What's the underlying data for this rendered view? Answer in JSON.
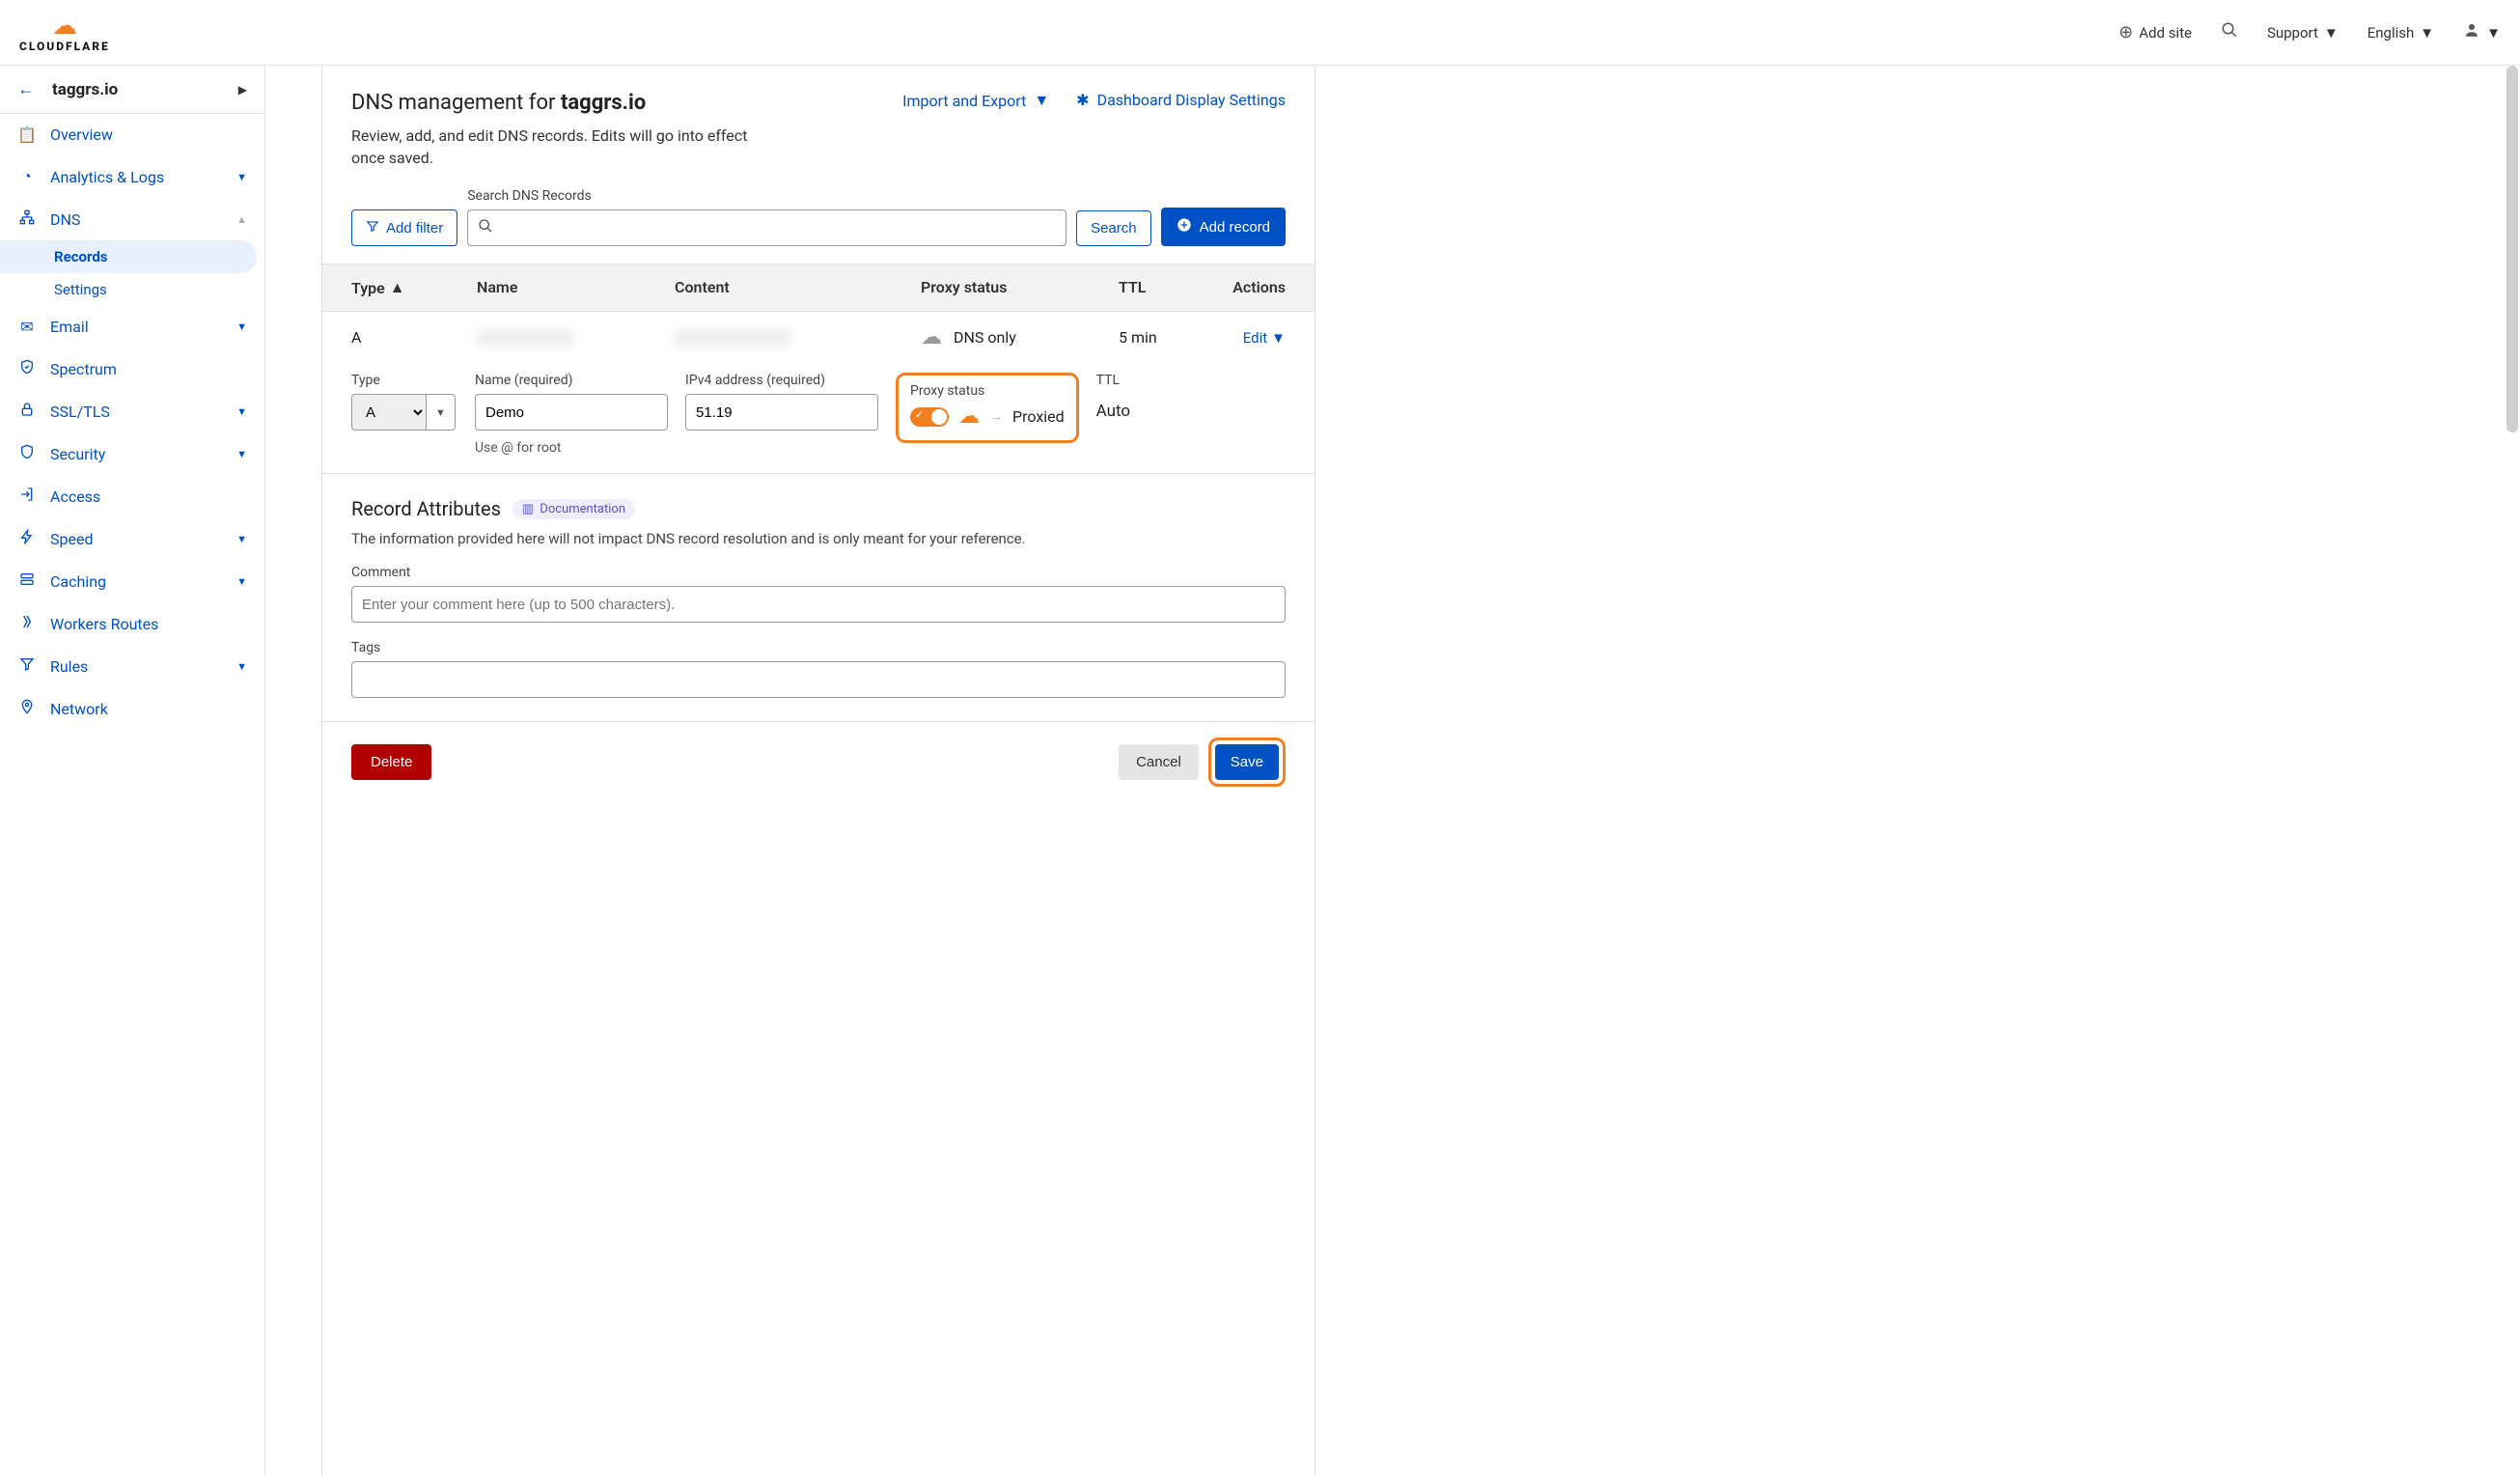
{
  "header": {
    "brand": "CLOUDFLARE",
    "add_site": "Add site",
    "support": "Support",
    "language": "English"
  },
  "breadcrumb": {
    "domain": "taggrs.io"
  },
  "nav": {
    "overview": "Overview",
    "analytics": "Analytics & Logs",
    "dns": "DNS",
    "dns_records": "Records",
    "dns_settings": "Settings",
    "email": "Email",
    "spectrum": "Spectrum",
    "ssl": "SSL/TLS",
    "security": "Security",
    "access": "Access",
    "speed": "Speed",
    "caching": "Caching",
    "workers": "Workers Routes",
    "rules": "Rules",
    "network": "Network"
  },
  "page": {
    "title_prefix": "DNS management for ",
    "title_domain": "taggrs.io",
    "subtitle": "Review, add, and edit DNS records. Edits will go into effect once saved.",
    "import_export": "Import and Export",
    "display_settings": "Dashboard Display Settings"
  },
  "toolbar": {
    "add_filter": "Add filter",
    "search_label": "Search DNS Records",
    "search_btn": "Search",
    "add_record": "Add record"
  },
  "table": {
    "headers": {
      "type": "Type",
      "name": "Name",
      "content": "Content",
      "proxy": "Proxy status",
      "ttl": "TTL",
      "actions": "Actions"
    },
    "row": {
      "type": "A",
      "name": "",
      "content": "",
      "proxy": "DNS only",
      "ttl": "5 min",
      "edit": "Edit"
    }
  },
  "form": {
    "type_label": "Type",
    "type_value": "A",
    "name_label": "Name (required)",
    "name_value": "Demo",
    "name_hint": "Use @ for root",
    "ip_label": "IPv4 address (required)",
    "ip_value": "51.19",
    "proxy_label": "Proxy status",
    "proxied": "Proxied",
    "ttl_label": "TTL",
    "ttl_value": "Auto"
  },
  "attrs": {
    "title": "Record Attributes",
    "docs": "Documentation",
    "subtitle": "The information provided here will not impact DNS record resolution and is only meant for your reference.",
    "comment_label": "Comment",
    "comment_placeholder": "Enter your comment here (up to 500 characters).",
    "tags_label": "Tags"
  },
  "actions": {
    "delete": "Delete",
    "cancel": "Cancel",
    "save": "Save"
  }
}
